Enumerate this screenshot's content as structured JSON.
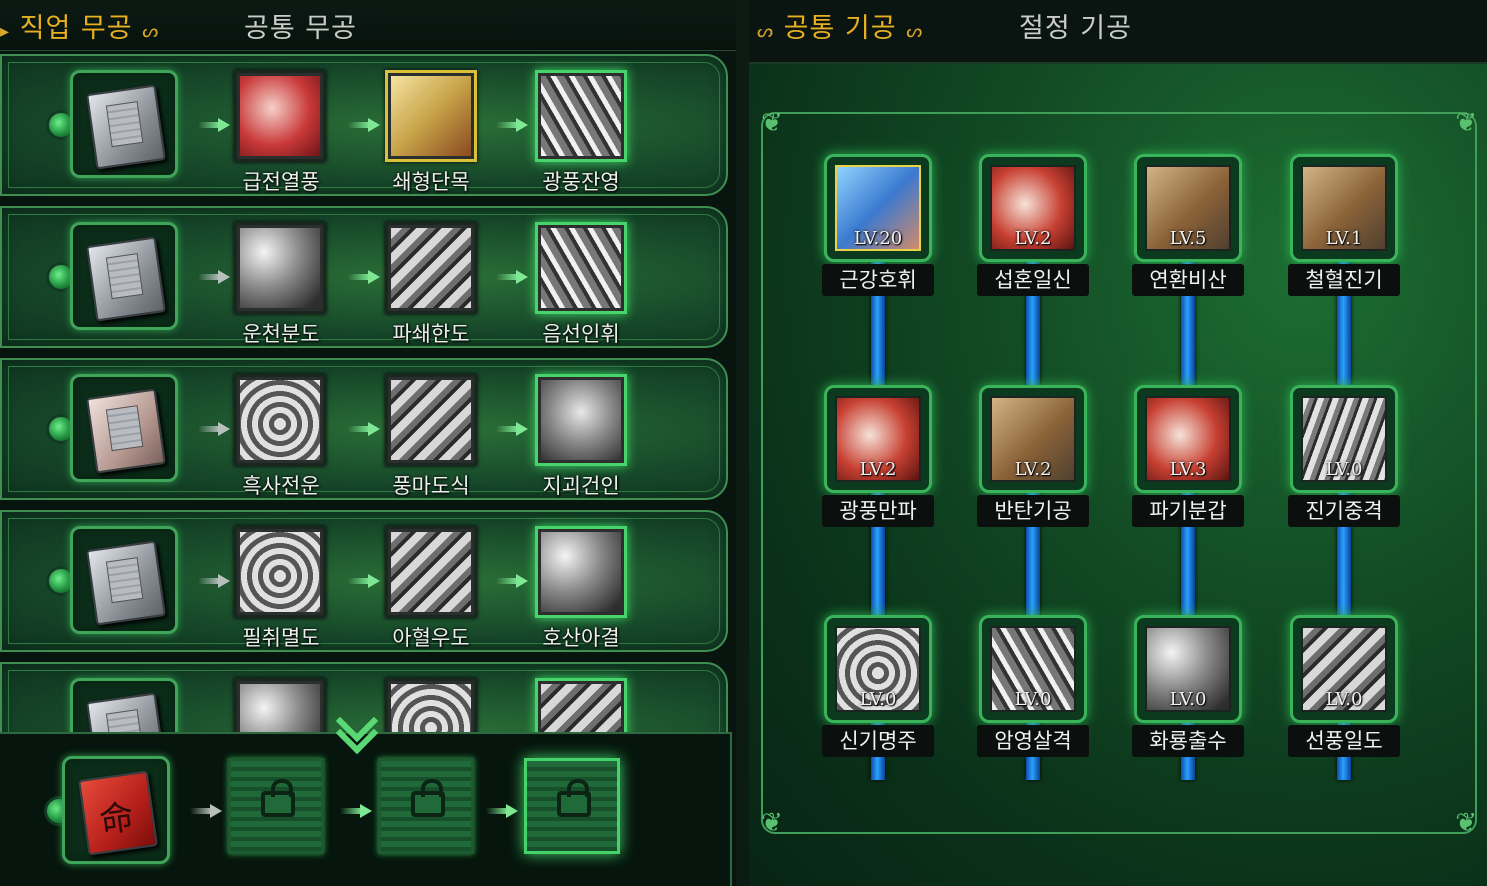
{
  "left_panel": {
    "tabs": [
      {
        "label": "직업 무공",
        "active": true
      },
      {
        "label": "공통 무공",
        "active": false
      }
    ],
    "rows": [
      {
        "skills": [
          "급전열풍",
          "쇄형단목",
          "광풍잔영"
        ]
      },
      {
        "skills": [
          "운천분도",
          "파쇄한도",
          "음선인휘"
        ]
      },
      {
        "skills": [
          "흑사전운",
          "풍마도식",
          "지괴건인"
        ]
      },
      {
        "skills": [
          "필취멸도",
          "아혈우도",
          "호산아결"
        ]
      }
    ]
  },
  "right_panel": {
    "tabs": [
      {
        "label": "공통 기공",
        "active": true
      },
      {
        "label": "절정 기공",
        "active": false
      }
    ],
    "skills": [
      {
        "name": "근강호휘",
        "level": "LV.20"
      },
      {
        "name": "섭혼일신",
        "level": "LV.2"
      },
      {
        "name": "연환비산",
        "level": "LV.5"
      },
      {
        "name": "철혈진기",
        "level": "LV.1"
      },
      {
        "name": "광풍만파",
        "level": "LV.2"
      },
      {
        "name": "반탄기공",
        "level": "LV.2"
      },
      {
        "name": "파기분갑",
        "level": "LV.3"
      },
      {
        "name": "진기중격",
        "level": "LV.0"
      },
      {
        "name": "신기명주",
        "level": "LV.0"
      },
      {
        "name": "암영살격",
        "level": "LV.0"
      },
      {
        "name": "화룡출수",
        "level": "LV.0"
      },
      {
        "name": "선풍일도",
        "level": "LV.0"
      }
    ]
  },
  "colors": {
    "active_tab": "#e6b020",
    "inactive_tab": "#c9ccc8",
    "skill_glow": "#3ed566",
    "connector": "#2aa0ff"
  },
  "icons": {
    "tab_ornament": "cloud-swirl-icon",
    "job_scroll": "manual-book-icon",
    "destiny_scroll": "fate-book-icon",
    "locked_slot": "padlock-icon",
    "expand": "chevron-down-icon"
  }
}
